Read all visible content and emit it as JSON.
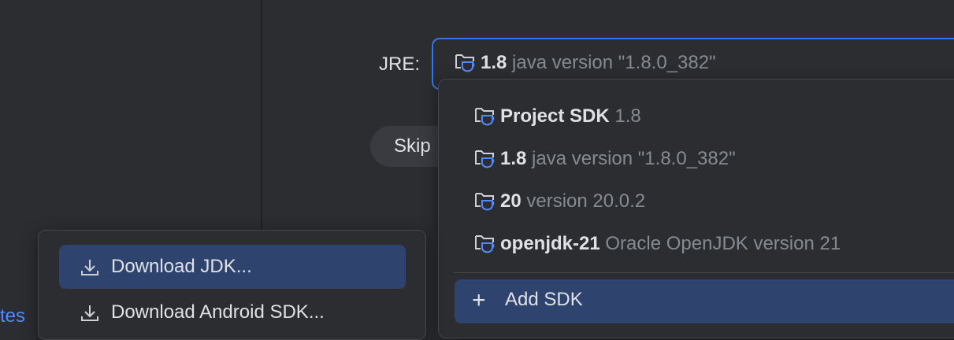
{
  "jre": {
    "label": "JRE:",
    "selected_name": "1.8",
    "selected_desc": "java version \"1.8.0_382\""
  },
  "skip_button": {
    "label": "Skip"
  },
  "sdk_list": {
    "items": [
      {
        "name": "Project SDK",
        "desc": "1.8"
      },
      {
        "name": "1.8",
        "desc": "java version \"1.8.0_382\""
      },
      {
        "name": "20",
        "desc": "version 20.0.2"
      },
      {
        "name": "openjdk-21",
        "desc": "Oracle OpenJDK version 21"
      }
    ],
    "add_label": "Add SDK"
  },
  "download_menu": {
    "items": [
      {
        "label": "Download JDK..."
      },
      {
        "label": "Download Android SDK..."
      }
    ]
  },
  "bottom_link": "tes",
  "icons": {
    "sdk": "folder-cup-icon",
    "download": "download-icon",
    "add": "plus-icon"
  },
  "colors": {
    "background": "#2b2d30",
    "accent": "#3574f0",
    "selection": "#2e436e",
    "text": "#dfe1e5",
    "secondary_text": "#868a91",
    "link": "#548af7"
  }
}
